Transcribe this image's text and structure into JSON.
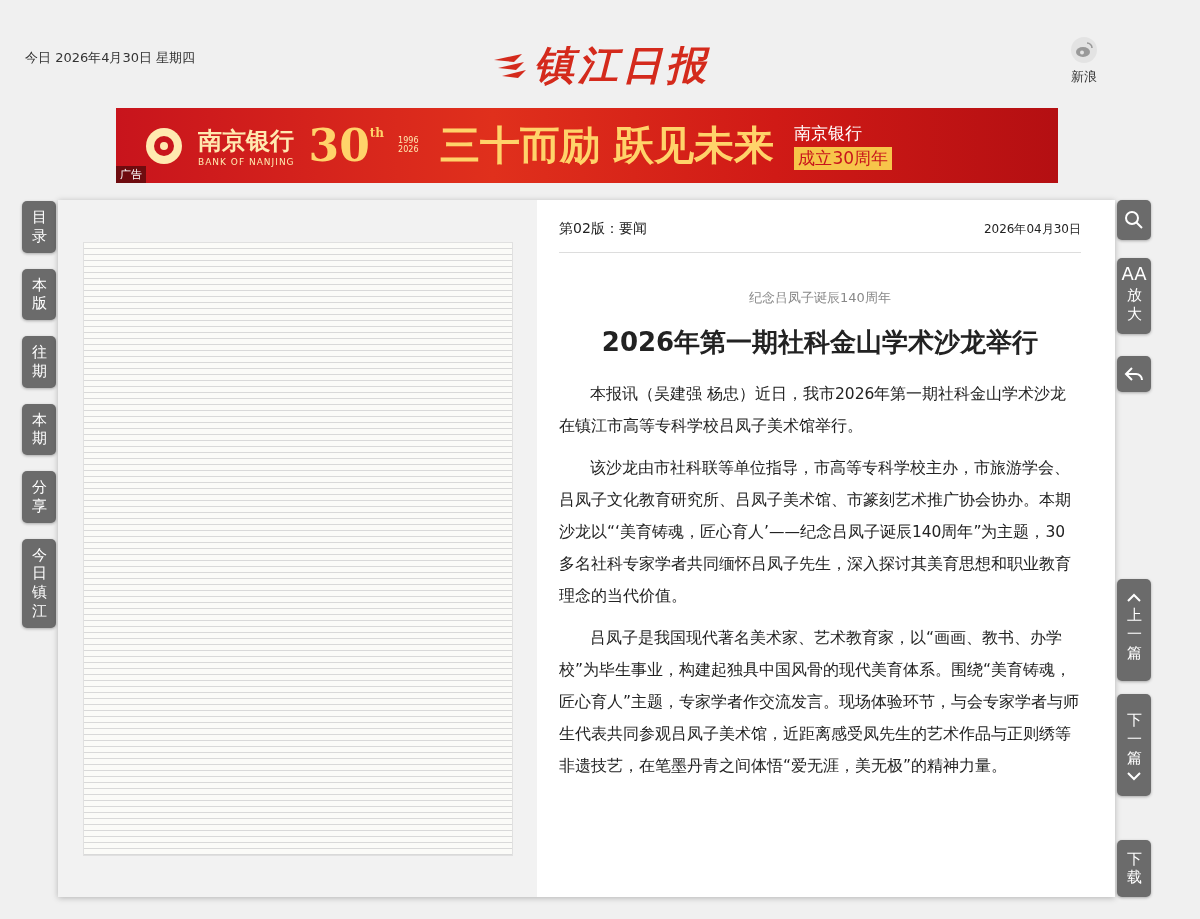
{
  "header": {
    "date": "今日 2026年4月30日 星期四",
    "logo": "镇江日报",
    "share": {
      "label": "新浪"
    }
  },
  "banner": {
    "brand": "南京银行",
    "brand_en": "BANK OF NANJING",
    "anniversary": "30",
    "anniversary_sup": "th",
    "years": "1996\n2026",
    "slogan": "三十而励 跃见未来",
    "caption_1": "南京银行",
    "caption_2": "成立30周年",
    "ad_label": "广告"
  },
  "left_nav": [
    {
      "label": "目录"
    },
    {
      "label": "本版"
    },
    {
      "label": "往期"
    },
    {
      "label": "本期"
    },
    {
      "label": "分享"
    },
    {
      "label": "今日镇江"
    }
  ],
  "right_tools": [
    {
      "kind": "search"
    },
    {
      "kind": "zoom",
      "icon_text": "AA",
      "label": "放大"
    },
    {
      "kind": "back"
    },
    {
      "kind": "prev",
      "label": "上一篇"
    },
    {
      "kind": "next",
      "label": "下一篇"
    },
    {
      "kind": "download",
      "label": "下载"
    }
  ],
  "article": {
    "section": "第02版：要闻",
    "date": "2026年04月30日",
    "kicker": "纪念吕凤子诞辰140周年",
    "title": "2026年第一期社科金山学术沙龙举行",
    "paragraphs": [
      "本报讯（吴建强 杨忠）近日，我市2026年第一期社科金山学术沙龙在镇江市高等专科学校吕凤子美术馆举行。",
      "该沙龙由市社科联等单位指导，市高等专科学校主办，市旅游学会、吕凤子文化教育研究所、吕凤子美术馆、市篆刻艺术推广协会协办。本期沙龙以“‘美育铸魂，匠心育人’——纪念吕凤子诞辰140周年”为主题，30多名社科专家学者共同缅怀吕凤子先生，深入探讨其美育思想和职业教育理念的当代价值。",
      "吕凤子是我国现代著名美术家、艺术教育家，以“画画、教书、办学校”为毕生事业，构建起独具中国风骨的现代美育体系。围绕“美育铸魂，匠心育人”主题，专家学者作交流发言。现场体验环节，与会专家学者与师生代表共同参观吕凤子美术馆，近距离感受凤先生的艺术作品与正则绣等非遗技艺，在笔墨丹青之间体悟“爱无涯，美无极”的精神力量。"
    ]
  }
}
